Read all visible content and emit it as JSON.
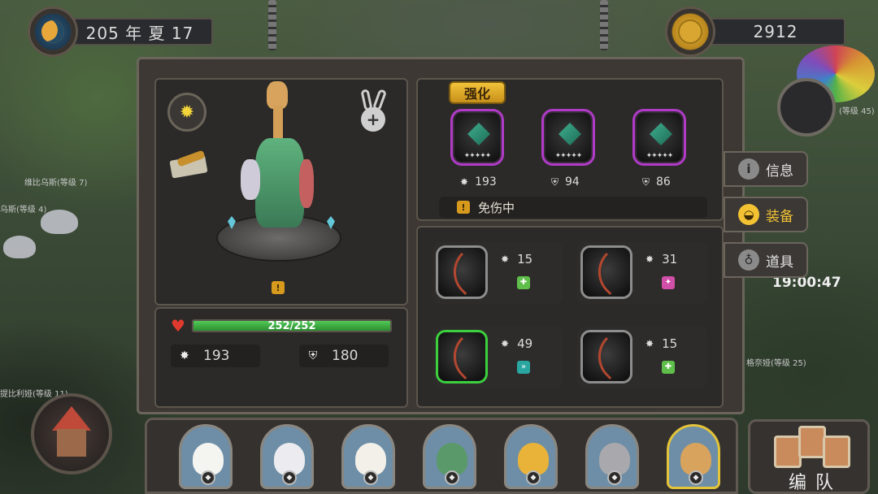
{
  "hud": {
    "date_text": "205 年 夏 17",
    "gold": "2912",
    "clock": "19:00:47"
  },
  "world_labels": {
    "mob1": "维比乌斯(等级 7)",
    "mob2": "乌斯(等级 4)",
    "mob3": "提比利娅(等级 11)",
    "mob4": "格奈娅(等级 25)",
    "mob5": "(等级 45)"
  },
  "hero": {
    "hp_text": "252/252",
    "hp_fraction": 1.0,
    "attack": "193",
    "defense": "180"
  },
  "equipment": {
    "enhance_label": "强化",
    "slots": [
      {
        "value": "193",
        "stat_icon": "attack-icon",
        "rarity_color": "#b03bc7"
      },
      {
        "value": "94",
        "stat_icon": "defense-icon",
        "rarity_color": "#b03bc7"
      },
      {
        "value": "86",
        "stat_icon": "defense-icon",
        "rarity_color": "#b03bc7"
      }
    ],
    "status_text": "免伤中"
  },
  "gear": [
    {
      "value": "15",
      "frame": "gray",
      "badge_color": "#5fbf4a",
      "badge_icon": "heal-icon"
    },
    {
      "value": "31",
      "frame": "gray",
      "badge_color": "#d04fa8",
      "badge_icon": "magic-icon"
    },
    {
      "value": "49",
      "frame": "green",
      "badge_color": "#2aa6a0",
      "badge_icon": "speed-icon"
    },
    {
      "value": "15",
      "frame": "gray",
      "badge_color": "#5fbf4a",
      "badge_icon": "heal-icon"
    }
  ],
  "side_tabs": [
    {
      "label": "信息",
      "icon": "info-icon",
      "active": false
    },
    {
      "label": "装备",
      "icon": "helmet-icon",
      "active": true
    },
    {
      "label": "道具",
      "icon": "bag-icon",
      "active": false
    }
  ],
  "roster": {
    "team_label": "编 队",
    "portraits": [
      {
        "name": "eagle",
        "bg": "#6d8ea6",
        "face": "#f4f4f0"
      },
      {
        "name": "polar-bear",
        "bg": "#6d8ea6",
        "face": "#ececf0"
      },
      {
        "name": "goat",
        "bg": "#6d8ea6",
        "face": "#f3f0ea"
      },
      {
        "name": "crocodile",
        "bg": "#6d8ea6",
        "face": "#5a9a6a"
      },
      {
        "name": "leopard",
        "bg": "#6d8ea6",
        "face": "#e9b33a"
      },
      {
        "name": "elephant",
        "bg": "#6d8ea6",
        "face": "#a9a9ad"
      },
      {
        "name": "giraffe",
        "bg": "#6d8ea6",
        "face": "#d8a35c"
      }
    ],
    "selected_index": 6
  }
}
